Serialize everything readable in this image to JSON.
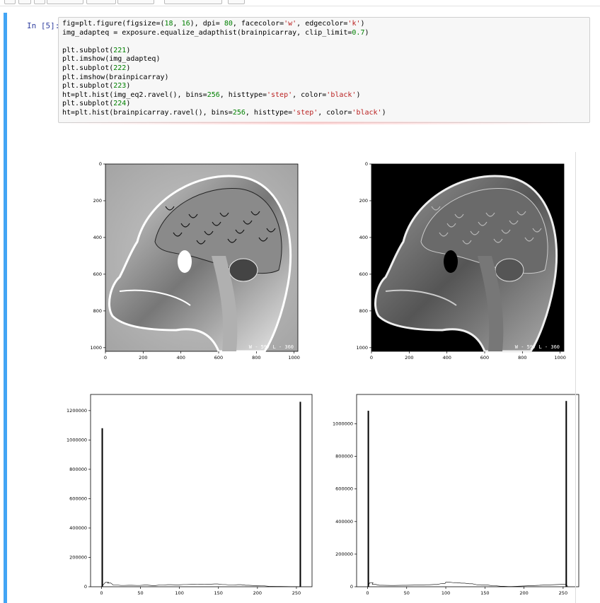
{
  "cell": {
    "prompt": "In [5]:",
    "code_lines": [
      [
        {
          "t": "fig=plt.figure(figsize=("
        },
        {
          "t": "18",
          "c": "num"
        },
        {
          "t": ", "
        },
        {
          "t": "16",
          "c": "num"
        },
        {
          "t": "), dpi= "
        },
        {
          "t": "80",
          "c": "num"
        },
        {
          "t": ", facecolor="
        },
        {
          "t": "'w'",
          "c": "str"
        },
        {
          "t": ", edgecolor="
        },
        {
          "t": "'k'",
          "c": "str"
        },
        {
          "t": ")"
        }
      ],
      [
        {
          "t": "img_adapteq = exposure.equalize_adapthist(brainpicarray, clip_limit="
        },
        {
          "t": "0.7",
          "c": "num"
        },
        {
          "t": ")"
        }
      ],
      [
        {
          "t": ""
        }
      ],
      [
        {
          "t": "plt.subplot("
        },
        {
          "t": "221",
          "c": "num"
        },
        {
          "t": ")"
        }
      ],
      [
        {
          "t": "plt.imshow(img_adapteq)"
        }
      ],
      [
        {
          "t": "plt.subplot("
        },
        {
          "t": "222",
          "c": "num"
        },
        {
          "t": ")"
        }
      ],
      [
        {
          "t": "plt.imshow(brainpicarray)"
        }
      ],
      [
        {
          "t": "plt.subplot("
        },
        {
          "t": "223",
          "c": "num"
        },
        {
          "t": ")"
        }
      ],
      [
        {
          "t": "ht=plt.hist(img_eq2.ravel(), bins="
        },
        {
          "t": "256",
          "c": "num"
        },
        {
          "t": ", histtype="
        },
        {
          "t": "'step'",
          "c": "str"
        },
        {
          "t": ", color="
        },
        {
          "t": "'black'",
          "c": "str"
        },
        {
          "t": ")"
        }
      ],
      [
        {
          "t": "plt.subplot("
        },
        {
          "t": "224",
          "c": "num"
        },
        {
          "t": ")"
        }
      ],
      [
        {
          "t": "ht=plt.hist(brainpicarray.ravel(), bins="
        },
        {
          "t": "256",
          "c": "num"
        },
        {
          "t": ", histtype="
        },
        {
          "t": "'step'",
          "c": "str"
        },
        {
          "t": ", color="
        },
        {
          "t": "'black'",
          "c": "str"
        },
        {
          "t": ")"
        }
      ]
    ]
  },
  "colors": {
    "cell_bar": "#42a5f5",
    "prompt": "#303f9f",
    "code_number": "#008000",
    "code_string": "#ba2121"
  },
  "chart_data": [
    {
      "type": "image",
      "subplot": "221",
      "caption_overlay": "W - 597 L - 360",
      "x_ticks": [
        0,
        200,
        400,
        600,
        800,
        1000
      ],
      "y_ticks": [
        0,
        200,
        400,
        600,
        800,
        1000
      ],
      "background": "gray"
    },
    {
      "type": "image",
      "subplot": "222",
      "caption_overlay": "W - 597 L - 360",
      "x_ticks": [
        0,
        200,
        400,
        600,
        800,
        1000
      ],
      "y_ticks": [
        0,
        200,
        400,
        600,
        800,
        1000
      ],
      "background": "black"
    },
    {
      "type": "bar",
      "subplot": "223",
      "xlim": [
        -14,
        270
      ],
      "ylim": [
        0,
        1310000
      ],
      "x_ticks": [
        0,
        50,
        100,
        150,
        200,
        250
      ],
      "y_ticks": [
        0,
        200000,
        400000,
        600000,
        800000,
        1000000,
        1200000
      ],
      "spikes": [
        {
          "x": 1,
          "y": 1080000
        },
        {
          "x": 255,
          "y": 1260000
        }
      ],
      "baseline_bumps": [
        {
          "x": 5,
          "y": 30000
        },
        {
          "x": 8,
          "y": 25000
        },
        {
          "x": 15,
          "y": 12000
        },
        {
          "x": 25,
          "y": 9000
        },
        {
          "x": 35,
          "y": 10000
        },
        {
          "x": 45,
          "y": 9000
        },
        {
          "x": 55,
          "y": 11000
        },
        {
          "x": 65,
          "y": 8000
        },
        {
          "x": 75,
          "y": 12000
        },
        {
          "x": 85,
          "y": 14000
        },
        {
          "x": 95,
          "y": 13000
        },
        {
          "x": 105,
          "y": 15000
        },
        {
          "x": 115,
          "y": 16000
        },
        {
          "x": 125,
          "y": 18000
        },
        {
          "x": 135,
          "y": 17000
        },
        {
          "x": 145,
          "y": 19000
        },
        {
          "x": 155,
          "y": 15000
        },
        {
          "x": 165,
          "y": 12000
        },
        {
          "x": 175,
          "y": 14000
        },
        {
          "x": 185,
          "y": 10000
        },
        {
          "x": 195,
          "y": 8000
        },
        {
          "x": 205,
          "y": 6000
        },
        {
          "x": 215,
          "y": 3000
        },
        {
          "x": 225,
          "y": 2000
        }
      ],
      "grid": false
    },
    {
      "type": "bar",
      "subplot": "224",
      "xlim": [
        -14,
        270
      ],
      "ylim": [
        0,
        1180000
      ],
      "x_ticks": [
        0,
        50,
        100,
        150,
        200,
        250
      ],
      "y_ticks": [
        0,
        200000,
        400000,
        600000,
        800000,
        1000000
      ],
      "spikes": [
        {
          "x": 1,
          "y": 1080000
        },
        {
          "x": 254,
          "y": 1140000
        }
      ],
      "baseline_bumps": [
        {
          "x": 3,
          "y": 25000
        },
        {
          "x": 6,
          "y": 15000
        },
        {
          "x": 15,
          "y": 9000
        },
        {
          "x": 30,
          "y": 8000
        },
        {
          "x": 45,
          "y": 9000
        },
        {
          "x": 60,
          "y": 10000
        },
        {
          "x": 75,
          "y": 12000
        },
        {
          "x": 85,
          "y": 14000
        },
        {
          "x": 95,
          "y": 20000
        },
        {
          "x": 100,
          "y": 28000
        },
        {
          "x": 110,
          "y": 25000
        },
        {
          "x": 120,
          "y": 22000
        },
        {
          "x": 130,
          "y": 18000
        },
        {
          "x": 140,
          "y": 12000
        },
        {
          "x": 150,
          "y": 10000
        },
        {
          "x": 160,
          "y": 6000
        },
        {
          "x": 170,
          "y": 3000
        },
        {
          "x": 180,
          "y": 1500
        },
        {
          "x": 250,
          "y": 15000
        }
      ],
      "grid": false
    }
  ]
}
